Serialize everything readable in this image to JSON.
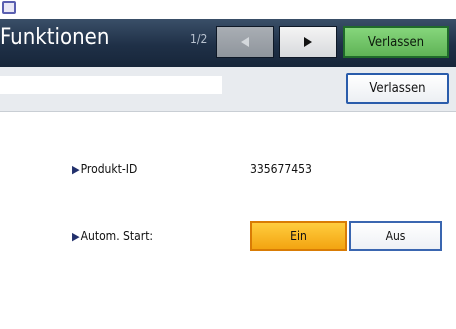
{
  "header": {
    "title": "Funktionen",
    "page_indicator": "1/2",
    "prev_icon": "triangle-left-icon",
    "next_icon": "triangle-right-icon",
    "exit_label": "Verlassen"
  },
  "toolbar": {
    "exit_label": "Verlassen"
  },
  "rows": {
    "product": {
      "label": "Produkt-ID",
      "value": "335677453"
    },
    "autostart": {
      "label": "Autom. Start:",
      "on_label": "Ein",
      "off_label": "Aus",
      "selected": "Ein"
    }
  },
  "colors": {
    "title_bar": "#1f3047",
    "selected_option": "#f7b21f",
    "exit_top": "#6fc463",
    "exit_border": "#2a5cab"
  }
}
